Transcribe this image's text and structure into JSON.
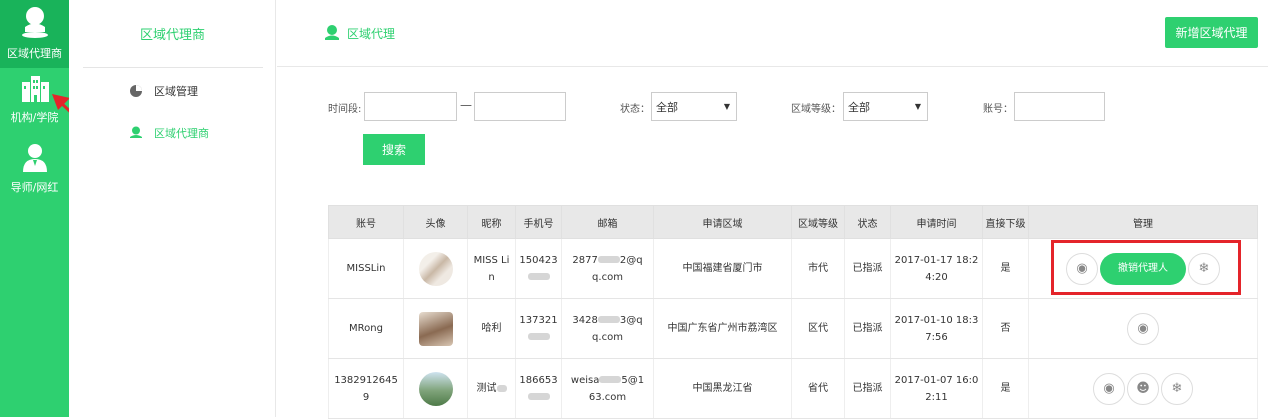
{
  "left_nav": {
    "items": [
      {
        "label": "区域代理商",
        "icon": "user-pin-icon",
        "active": true
      },
      {
        "label": "机构/学院",
        "icon": "building-icon",
        "active": false
      },
      {
        "label": "导师/网红",
        "icon": "person-icon",
        "active": false
      }
    ]
  },
  "sub_nav": {
    "title": "区域代理商",
    "items": [
      {
        "label": "区域管理",
        "icon": "pie-chart-icon"
      },
      {
        "label": "区域代理商",
        "icon": "user-pin-icon",
        "active": true
      }
    ]
  },
  "header": {
    "breadcrumb": "区域代理",
    "add_button": "新增区域代理"
  },
  "filters": {
    "time_label": "时间段:",
    "dash": "—",
    "status_label": "状态：",
    "status_value": "全部",
    "level_label": "区域等级：",
    "level_value": "全部",
    "account_label": "账号：",
    "search_button": "搜索"
  },
  "table": {
    "headers": [
      "账号",
      "头像",
      "昵称",
      "手机号",
      "邮箱",
      "申请区域",
      "区域等级",
      "状态",
      "申请时间",
      "直接下级",
      "管理"
    ],
    "rows": [
      {
        "account": "MISSLin",
        "nickname_1": "MISS Li",
        "nickname_2": "n",
        "phone": "150423",
        "email_1": "2877",
        "email_2": "2@q",
        "email_3": "q.com",
        "region": "中国福建省厦门市",
        "level": "市代",
        "status": "已指派",
        "time_1": "2017-01-17 18:2",
        "time_2": "4:20",
        "direct": "是",
        "revoke_label": "撤销代理人"
      },
      {
        "account": "MRong",
        "nickname_1": "哈利",
        "phone": "137321",
        "email_1": "3428",
        "email_2": "3@q",
        "email_3": "q.com",
        "region": "中国广东省广州市荔湾区",
        "level": "区代",
        "status": "已指派",
        "time_1": "2017-01-10 18:3",
        "time_2": "7:56",
        "direct": "否"
      },
      {
        "account_1": "1382912645",
        "account_2": "9",
        "nickname_1": "测试",
        "phone": "186653",
        "email_1": "weisa",
        "email_2": "5@1",
        "email_3": "63.com",
        "region": "中国黑龙江省",
        "level": "省代",
        "status": "已指派",
        "time_1": "2017-01-07 16:0",
        "time_2": "2:11",
        "direct": "是"
      }
    ]
  },
  "colors": {
    "brand": "#2ed070",
    "highlight": "#e4242a"
  }
}
